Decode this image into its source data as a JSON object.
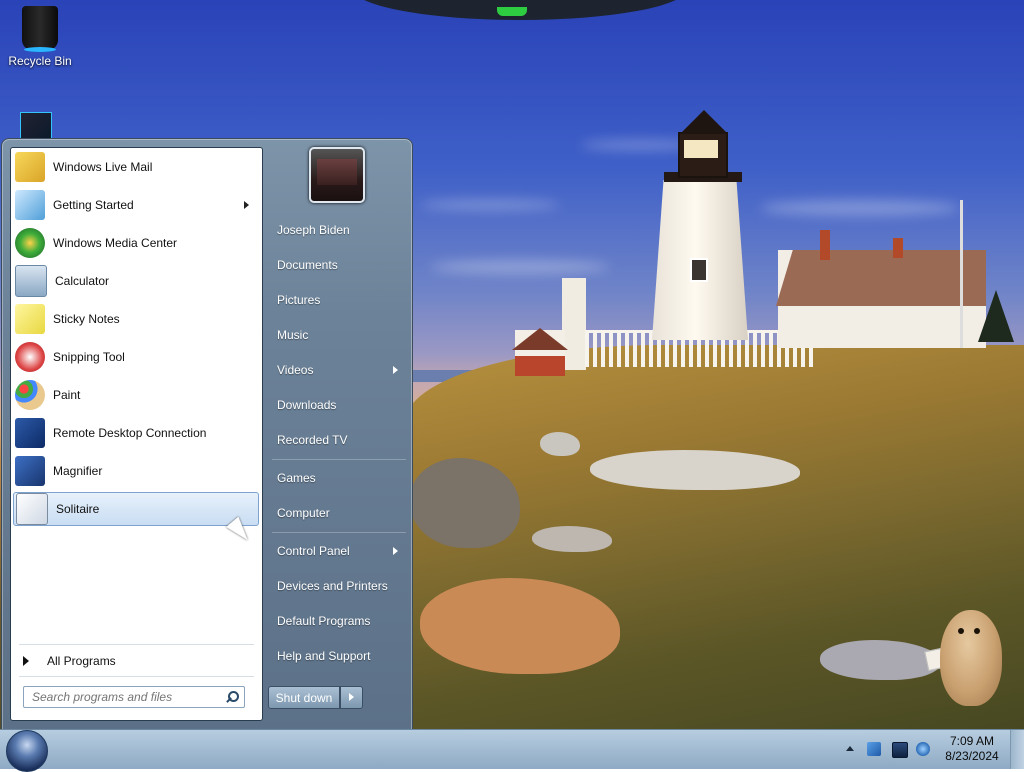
{
  "desktop": {
    "icons": [
      {
        "label": "Recycle Bin",
        "icon": "recycle-bin-icon"
      }
    ]
  },
  "start_menu": {
    "programs": [
      {
        "label": "Windows Live Mail",
        "icon": "mail-icon",
        "submenu": false
      },
      {
        "label": "Getting Started",
        "icon": "getting-started-icon",
        "submenu": true
      },
      {
        "label": "Windows Media Center",
        "icon": "media-center-icon",
        "submenu": false
      },
      {
        "label": "Calculator",
        "icon": "calculator-icon",
        "submenu": false
      },
      {
        "label": "Sticky Notes",
        "icon": "sticky-notes-icon",
        "submenu": false
      },
      {
        "label": "Snipping Tool",
        "icon": "scissors-icon",
        "submenu": false
      },
      {
        "label": "Paint",
        "icon": "paint-palette-icon",
        "submenu": false
      },
      {
        "label": "Remote Desktop Connection",
        "icon": "remote-desktop-icon",
        "submenu": false
      },
      {
        "label": "Magnifier",
        "icon": "magnifier-icon",
        "submenu": false
      },
      {
        "label": "Solitaire",
        "icon": "cards-icon",
        "submenu": false,
        "selected": true
      }
    ],
    "all_programs_label": "All Programs",
    "search_placeholder": "Search programs and files",
    "right_items": [
      {
        "label": "Joseph Biden",
        "submenu": false
      },
      {
        "label": "Documents",
        "submenu": false
      },
      {
        "label": "Pictures",
        "submenu": false
      },
      {
        "label": "Music",
        "submenu": false
      },
      {
        "label": "Videos",
        "submenu": true
      },
      {
        "label": "Downloads",
        "submenu": false
      },
      {
        "label": "Recorded TV",
        "submenu": false
      },
      {
        "label": "Games",
        "submenu": false
      },
      {
        "label": "Computer",
        "submenu": false
      },
      {
        "label": "Control Panel",
        "submenu": true
      },
      {
        "label": "Devices and Printers",
        "submenu": false
      },
      {
        "label": "Default Programs",
        "submenu": false
      },
      {
        "label": "Help and Support",
        "submenu": false
      }
    ],
    "shutdown_label": "Shut down"
  },
  "taskbar": {
    "clock_time": "7:09 AM",
    "clock_date": "8/23/2024",
    "tray_icons": [
      "action-center-flag-icon",
      "display-icon",
      "network-icon"
    ]
  },
  "colors": {
    "taskbar_accent": "#a4bdd3",
    "selection_bg": "#c9ddf3"
  }
}
